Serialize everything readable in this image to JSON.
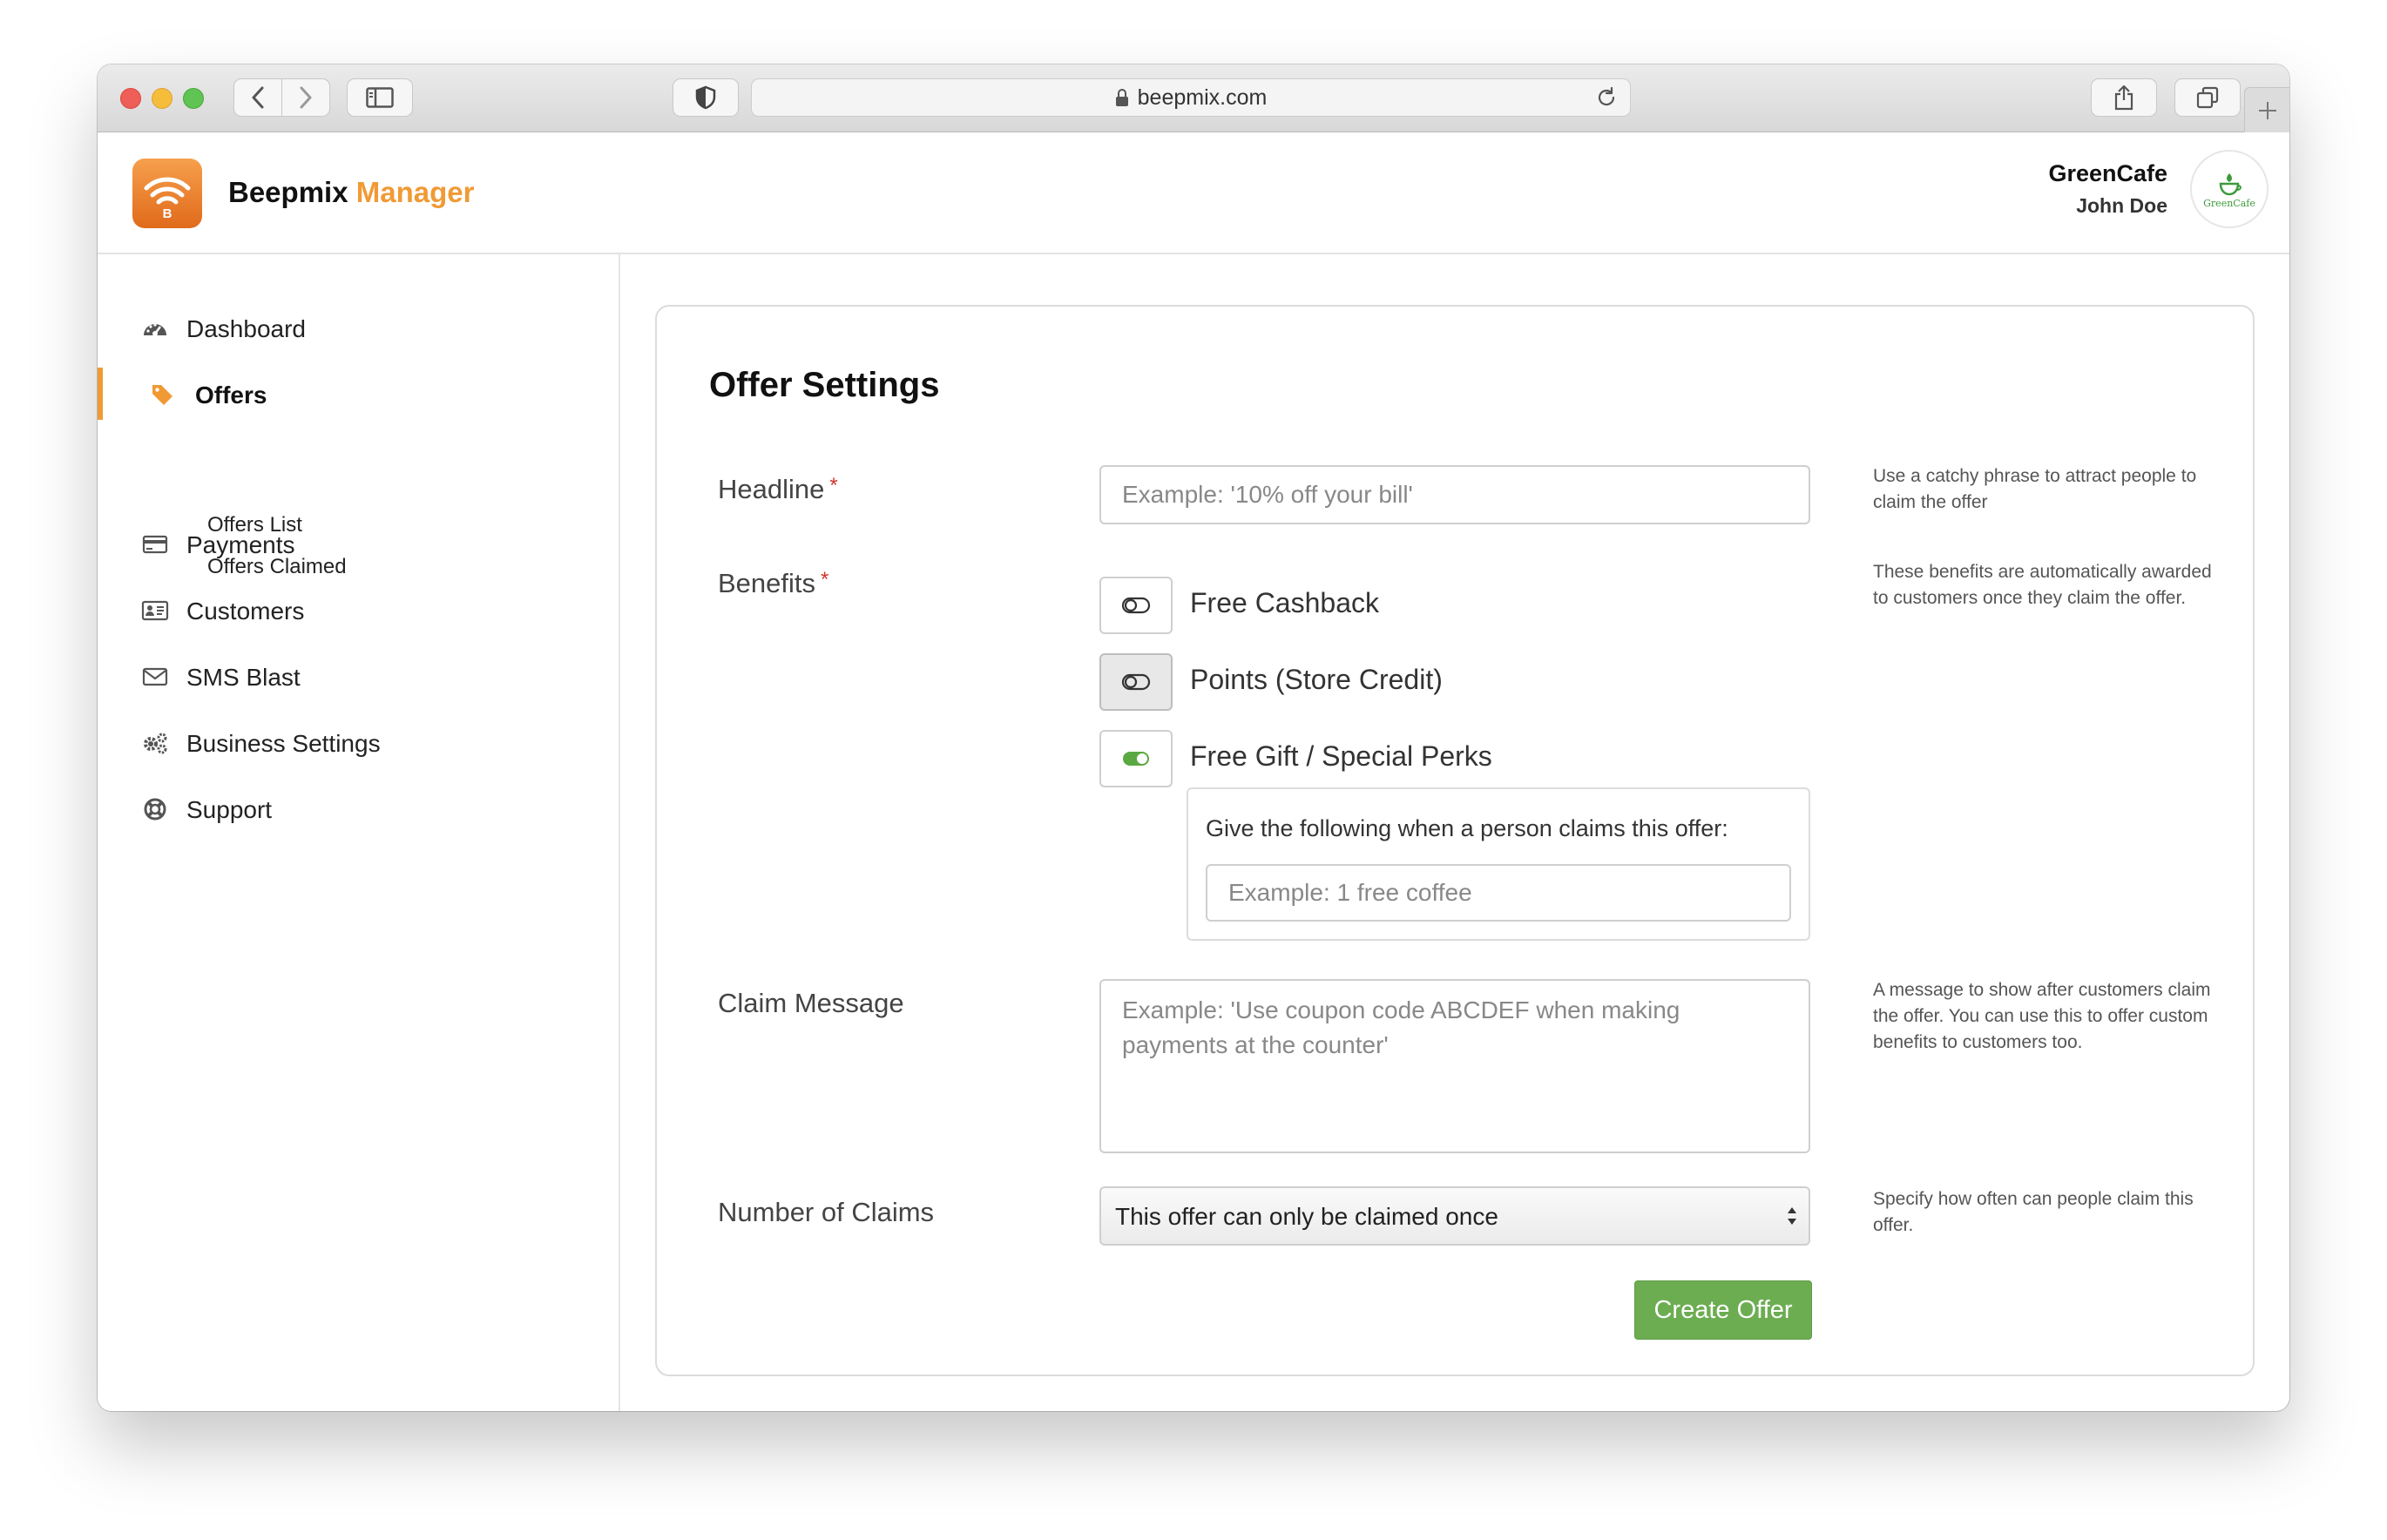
{
  "browser": {
    "url": "beepmix.com"
  },
  "header": {
    "brand_name": "Beepmix",
    "brand_accent": "Manager",
    "business_name": "GreenCafe",
    "user_name": "John Doe",
    "avatar_text": "GreenCafe"
  },
  "sidebar": {
    "items": [
      {
        "label": "Dashboard",
        "icon": "dashboard-icon"
      },
      {
        "label": "Offers",
        "icon": "tag-icon",
        "active": true
      },
      {
        "label": "Payments",
        "icon": "credit-card-icon"
      },
      {
        "label": "Customers",
        "icon": "id-card-icon"
      },
      {
        "label": "SMS Blast",
        "icon": "envelope-icon"
      },
      {
        "label": "Business Settings",
        "icon": "gears-icon"
      },
      {
        "label": "Support",
        "icon": "life-ring-icon"
      }
    ],
    "offers_sub": [
      "Offers List",
      "Offers Claimed"
    ]
  },
  "form": {
    "title": "Offer Settings",
    "required_mark": "*",
    "headline": {
      "label": "Headline",
      "placeholder": "Example: '10% off your bill'",
      "help": "Use a catchy phrase to attract people to claim the offer"
    },
    "benefits": {
      "label": "Benefits",
      "help": "These benefits are automatically awarded to customers once they claim the offer.",
      "options": [
        {
          "label": "Free Cashback",
          "enabled": false
        },
        {
          "label": "Points (Store Credit)",
          "enabled": false
        },
        {
          "label": "Free Gift / Special Perks",
          "enabled": true
        }
      ],
      "gift_prompt": "Give the following when a person claims this offer:",
      "gift_placeholder": "Example: 1 free coffee"
    },
    "claim_message": {
      "label": "Claim Message",
      "placeholder": "Example: 'Use coupon code ABCDEF when making payments at the counter'",
      "help": "A message to show after customers claim the offer. You can use this to offer custom benefits to customers too."
    },
    "number_of_claims": {
      "label": "Number of Claims",
      "selected": "This offer can only be claimed once",
      "help": "Specify how often can people claim this offer."
    },
    "submit_label": "Create Offer"
  },
  "colors": {
    "accent": "#f09a35",
    "button_green": "#6cad51",
    "toggle_on": "#5aa842",
    "required": "#d0342c"
  }
}
